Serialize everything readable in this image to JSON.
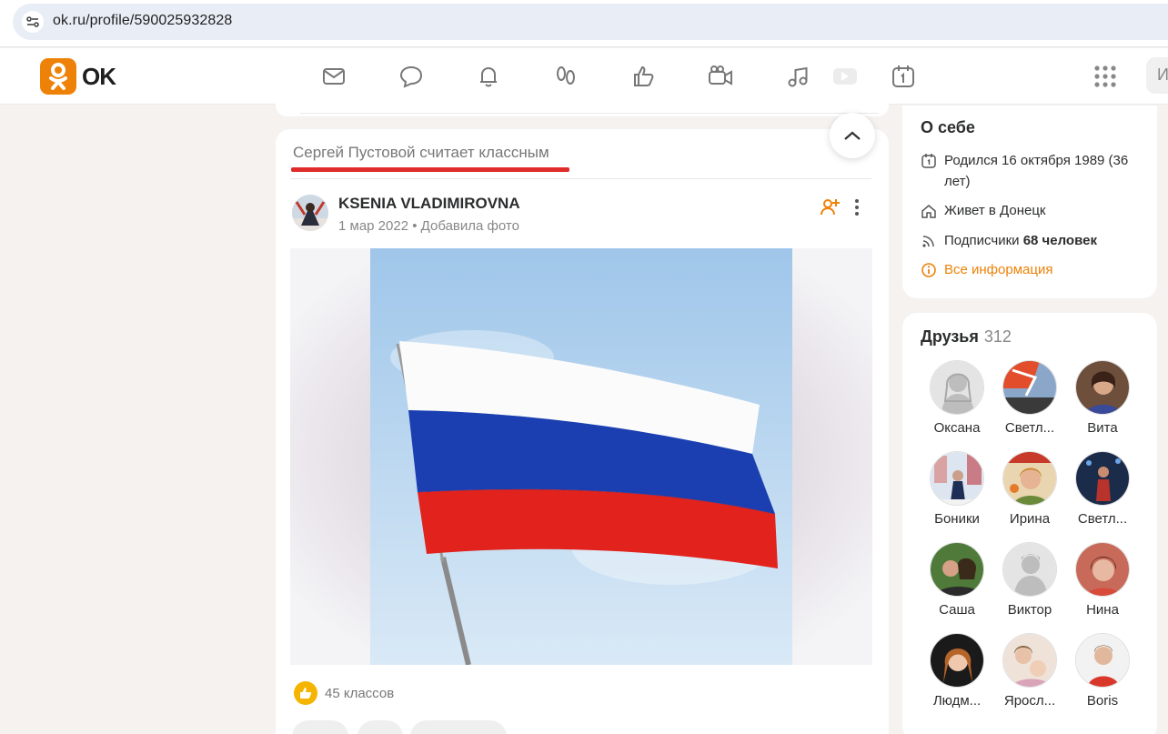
{
  "browser": {
    "url": "ok.ru/profile/590025932828"
  },
  "header": {
    "logo_text": "OK",
    "search_stub": "И",
    "nav_icons": [
      "messages-icon",
      "discussions-icon",
      "notifications-icon",
      "guests-icon",
      "likes-icon",
      "video-calls-icon",
      "music-icon",
      "video-icon",
      "events-icon"
    ]
  },
  "feed": {
    "tab_label": "Сергей Пустовой считает классным",
    "post": {
      "author": "KSENIA VLADIMIROVNA",
      "date": "1 мар 2022",
      "separator": "•",
      "action": "Добавила фото",
      "likes": "45 классов"
    }
  },
  "about": {
    "title": "О себе",
    "born": "Родился 16 октября 1989 (36 лет)",
    "lives": "Живет в Донецк",
    "subscribers_label": "Подписчики",
    "subscribers_value": "68 человек",
    "all_info": "Все информация"
  },
  "friends": {
    "title": "Друзья",
    "count": "312",
    "items": [
      {
        "name": "Оксана"
      },
      {
        "name": "Светл..."
      },
      {
        "name": "Вита"
      },
      {
        "name": "Боники"
      },
      {
        "name": "Ирина"
      },
      {
        "name": "Светл..."
      },
      {
        "name": "Саша"
      },
      {
        "name": "Виктор"
      },
      {
        "name": "Нина"
      },
      {
        "name": "Людм..."
      },
      {
        "name": "Яросл..."
      },
      {
        "name": "Boris"
      }
    ]
  },
  "colors": {
    "brand": "#ee8208",
    "accent_red": "#e02b2b",
    "flag_white": "#ffffff",
    "flag_blue": "#1b3fb0",
    "flag_red": "#e2221c"
  }
}
